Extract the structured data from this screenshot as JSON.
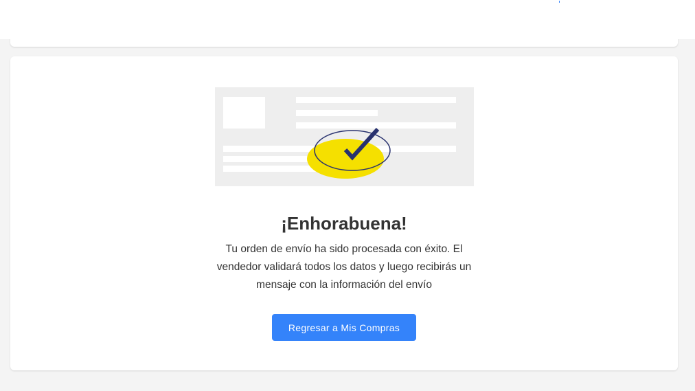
{
  "confirmation": {
    "title": "¡Enhorabuena!",
    "message": "Tu orden de envío ha sido procesada con éxito. El vendedor validará todos los datos y luego recibirás un mensaje con la información del envío",
    "button_label": "Regresar a Mis Compras"
  },
  "icons": {
    "illustration": "shipment-confirmed-illustration",
    "checkmark": "checkmark-icon"
  },
  "colors": {
    "accent": "#3483fa",
    "highlight": "#f5e000",
    "checkmark": "#28316e",
    "background": "#f4f4f4",
    "card": "#ffffff",
    "text": "#333333"
  }
}
